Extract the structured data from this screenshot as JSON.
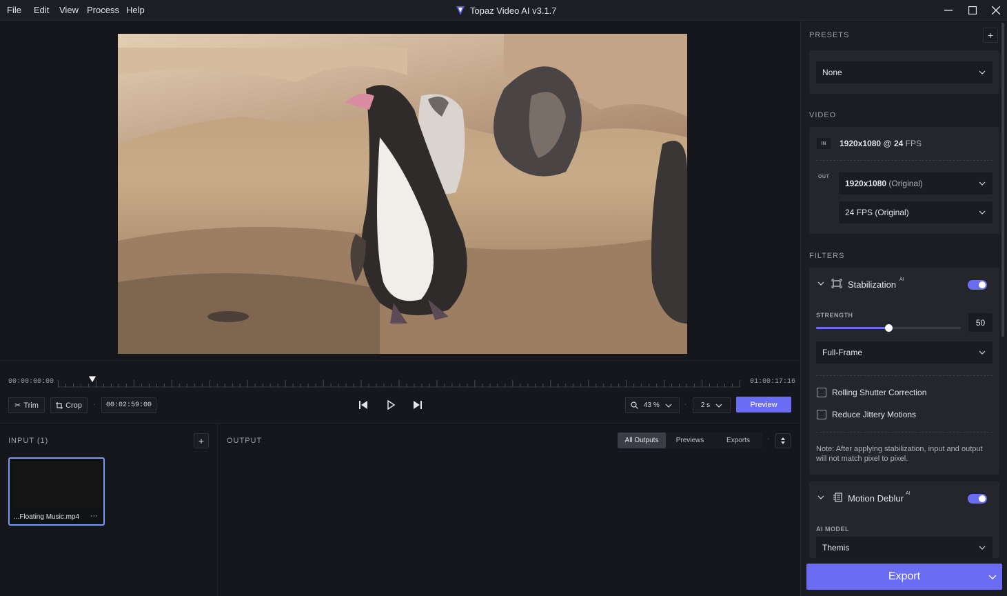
{
  "menu": [
    "File",
    "Edit",
    "View",
    "Process",
    "Help"
  ],
  "app_title": "Topaz Video AI  v3.1.7",
  "timeline": {
    "start_time": "00:00:00:00",
    "end_time": "01:00:17:16",
    "playhead_fraction": 0.05,
    "trim_label": "Trim",
    "crop_label": "Crop",
    "current_time": "00:02:59:00",
    "zoom": "43 %",
    "frame_step": "2 s",
    "preview_label": "Preview"
  },
  "input": {
    "title": "INPUT (1)",
    "file_name": "...Floating Music.mp4",
    "more": "···"
  },
  "output": {
    "title": "OUTPUT",
    "tabs": [
      "All Outputs",
      "Previews",
      "Exports"
    ]
  },
  "sidebar": {
    "presets_heading": "PRESETS",
    "preset_value": "None",
    "video_heading": "VIDEO",
    "in_badge": "IN",
    "in_resolution": "1920x1080",
    "in_at": " @ ",
    "in_fps": "24",
    "in_fps_unit": " FPS",
    "out_badge": "OUT",
    "out_resolution": "1920x1080",
    "out_resolution_note": " (Original)",
    "out_fps": "24 FPS (Original)",
    "filters_heading": "FILTERS",
    "stabilization": {
      "label": "Stabilization",
      "ai_badge": "AI",
      "enabled": true,
      "strength_label": "STRENGTH",
      "strength_value": "50",
      "strength_fraction": 0.5,
      "mode": "Full-Frame",
      "rolling_shutter": "Rolling Shutter Correction",
      "jittery": "Reduce Jittery Motions",
      "note": "Note: After applying stabilization, input and output will not match pixel to pixel."
    },
    "motion_deblur": {
      "label": "Motion Deblur",
      "ai_badge": "AI",
      "enabled": true,
      "ai_model_label": "AI MODEL",
      "ai_model": "Themis"
    },
    "export_label": "Export"
  },
  "colors": {
    "accent": "#6a6cf4",
    "background": "#15171c",
    "panel": "#1b1d22",
    "card": "#24262c"
  }
}
